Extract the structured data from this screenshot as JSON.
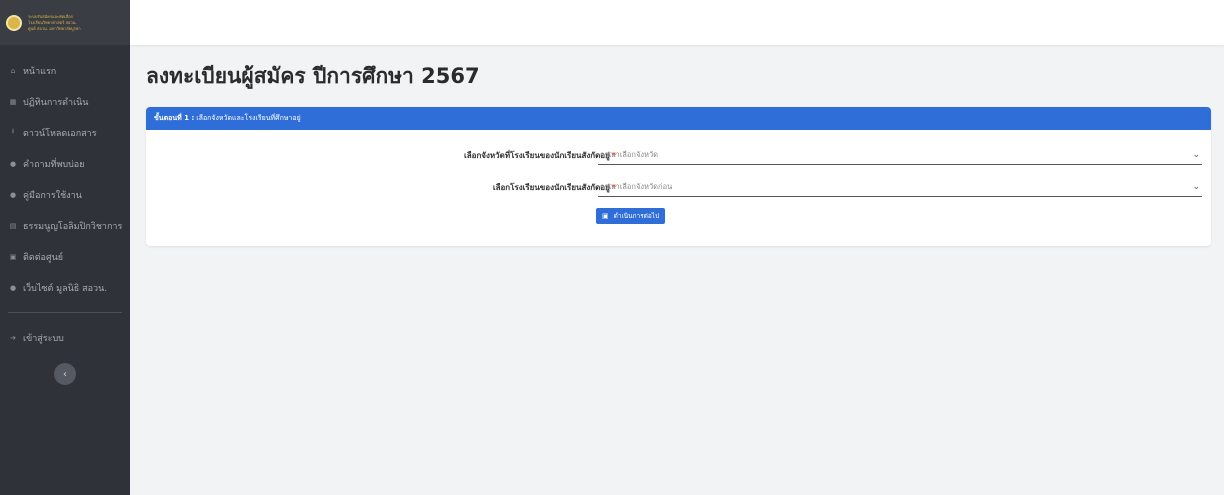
{
  "brand": {
    "line1": "ระบบรับสมัครและคัดเลือก",
    "line2": "โรงเรียนวิทยาศาสตร์ สอวน.",
    "line3": "ศูนย์ สอวน. มหาวิทยาลัยบูรพา"
  },
  "sidebar": {
    "items": [
      {
        "label": "หน้าแรก",
        "icon": "home-icon",
        "glyph": "⌂"
      },
      {
        "label": "ปฏิทินการดำเนิน",
        "icon": "calendar-icon",
        "glyph": "▦"
      },
      {
        "label": "ดาวน์โหลดเอกสาร",
        "icon": "download-icon",
        "glyph": "⭳"
      },
      {
        "label": "คำถามที่พบบ่อย",
        "icon": "question-icon",
        "glyph": "●"
      },
      {
        "label": "คู่มือการใช้งาน",
        "icon": "help-icon",
        "glyph": "●"
      },
      {
        "label": "ธรรมนูญโอลิมปิกวิชาการ",
        "icon": "document-icon",
        "glyph": "▤"
      },
      {
        "label": "ติดต่อศูนย์",
        "icon": "contact-icon",
        "glyph": "▣"
      },
      {
        "label": "เว็บไซต์ มูลนิธิ สอวน.",
        "icon": "globe-icon",
        "glyph": "●"
      }
    ],
    "login": {
      "label": "เข้าสู่ระบบ",
      "icon": "login-icon",
      "glyph": "➔"
    },
    "collapse_glyph": "‹"
  },
  "main": {
    "title": "ลงทะเบียนผู้สมัคร ปีการศึกษา 2567",
    "card": {
      "step_label": "ขั้นตอนที่ 1 :",
      "step_desc": "เลือกจังหวัดและโรงเรียนที่ศึกษาอยู่",
      "fields": [
        {
          "label": "เลือกจังหวัดที่โรงเรียนของนักเรียนสังกัดอยู่",
          "required": "*",
          "placeholder": "กรุณาเลือกจังหวัด"
        },
        {
          "label": "เลือกโรงเรียนของนักเรียนสังกัดอยู่",
          "required": "*",
          "placeholder": "กรุณาเลือกจังหวัดก่อน"
        }
      ],
      "submit_label": "ดำเนินการต่อไป",
      "submit_icon": "▣",
      "chevron": "⌄"
    }
  },
  "colors": {
    "sidebar_bg": "#2f3238",
    "accent": "#2f6ed8",
    "required": "#e53935",
    "brand_gold": "#d9b54a"
  }
}
